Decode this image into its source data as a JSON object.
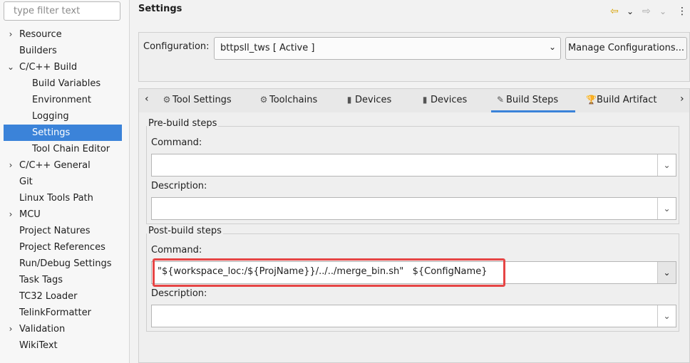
{
  "filter": {
    "placeholder": "type filter text"
  },
  "tree": [
    {
      "label": "Resource",
      "expander": "›"
    },
    {
      "label": "Builders",
      "expander": ""
    },
    {
      "label": "C/C++ Build",
      "expander": "⌄"
    },
    {
      "label": "Build Variables",
      "expander": ""
    },
    {
      "label": "Environment",
      "expander": ""
    },
    {
      "label": "Logging",
      "expander": ""
    },
    {
      "label": "Settings",
      "expander": ""
    },
    {
      "label": "Tool Chain Editor",
      "expander": ""
    },
    {
      "label": "C/C++ General",
      "expander": "›"
    },
    {
      "label": "Git",
      "expander": ""
    },
    {
      "label": "Linux Tools Path",
      "expander": ""
    },
    {
      "label": "MCU",
      "expander": "›"
    },
    {
      "label": "Project Natures",
      "expander": ""
    },
    {
      "label": "Project References",
      "expander": ""
    },
    {
      "label": "Run/Debug Settings",
      "expander": ""
    },
    {
      "label": "Task Tags",
      "expander": ""
    },
    {
      "label": "TC32 Loader",
      "expander": ""
    },
    {
      "label": "TelinkFormatter",
      "expander": ""
    },
    {
      "label": "Validation",
      "expander": "›"
    },
    {
      "label": "WikiText",
      "expander": ""
    }
  ],
  "header": {
    "title": "Settings",
    "icons": {
      "back": "⇦",
      "back_menu": "⌄",
      "forward": "⇨",
      "forward_menu": "⌄",
      "view_menu": "⋮"
    }
  },
  "configuration": {
    "label": "Configuration:",
    "value": "bttpsll_tws  [ Active ]",
    "chevron": "⌄",
    "manage_label": "Manage Configurations..."
  },
  "tabs": {
    "scroll_left": "‹",
    "scroll_right": "›",
    "items": [
      {
        "label": "Tool Settings",
        "icon": "⚙"
      },
      {
        "label": "Toolchains",
        "icon": "⚙"
      },
      {
        "label": "Devices",
        "icon": "▮"
      },
      {
        "label": "Devices",
        "icon": "▮"
      },
      {
        "label": "Build Steps",
        "icon": "✎"
      },
      {
        "label": "Build Artifact",
        "icon": "🏆"
      }
    ]
  },
  "prebuild": {
    "title": "Pre-build steps",
    "command_label": "Command:",
    "command_value": "",
    "description_label": "Description:",
    "description_value": ""
  },
  "postbuild": {
    "title": "Post-build steps",
    "command_label": "Command:",
    "command_value": "\"${workspace_loc:/${ProjName}}/../../merge_bin.sh\"   ${ConfigName}",
    "description_label": "Description:",
    "description_value": ""
  },
  "combo_chevron": "⌄",
  "colors": {
    "selection": "#3b83d9",
    "highlight": "#e64545"
  }
}
